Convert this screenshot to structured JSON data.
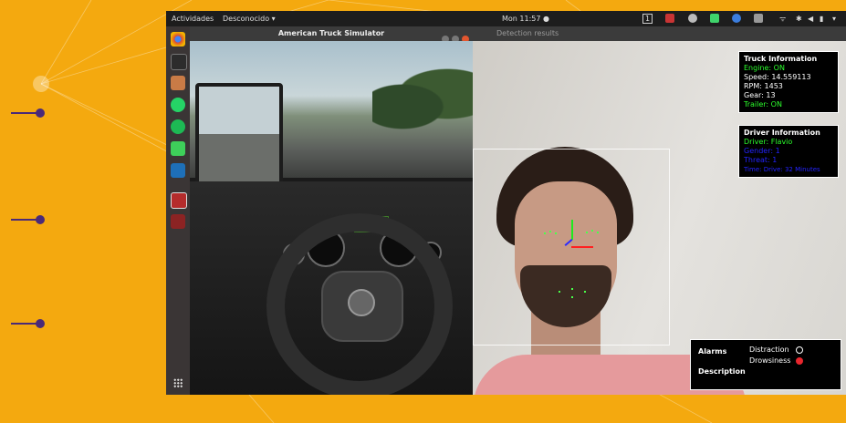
{
  "topbar": {
    "activities": "Actividades",
    "app_menu": "Desconocido ▾",
    "clock": "Mon 11:57 ●",
    "workspace": "1"
  },
  "ats_window": {
    "title": "American Truck Simulator"
  },
  "detection_window": {
    "title": "Detection results"
  },
  "truck_info": {
    "header": "Truck Information",
    "engine": "Engine: ON",
    "speed": "Speed: 14.559113",
    "rpm": "RPM: 1453",
    "gear": "Gear: 13",
    "trailer": "Trailer: ON"
  },
  "driver_info": {
    "header": "Driver Information",
    "driver": "Driver: Flavio",
    "line2": "Gender: 1",
    "line3": "Threat: 1",
    "line4": "Time: Drive: 32 Minutes"
  },
  "alarms": {
    "header": "Alarms",
    "description": "Description",
    "distraction": "Distraction",
    "drowsiness": "Drowsiness"
  },
  "colors": {
    "background": "#f4a90f",
    "accent": "#4a2a78",
    "info_green": "#2cff2c",
    "info_blue": "#2424ff",
    "alarm_active": "#e8262d"
  }
}
